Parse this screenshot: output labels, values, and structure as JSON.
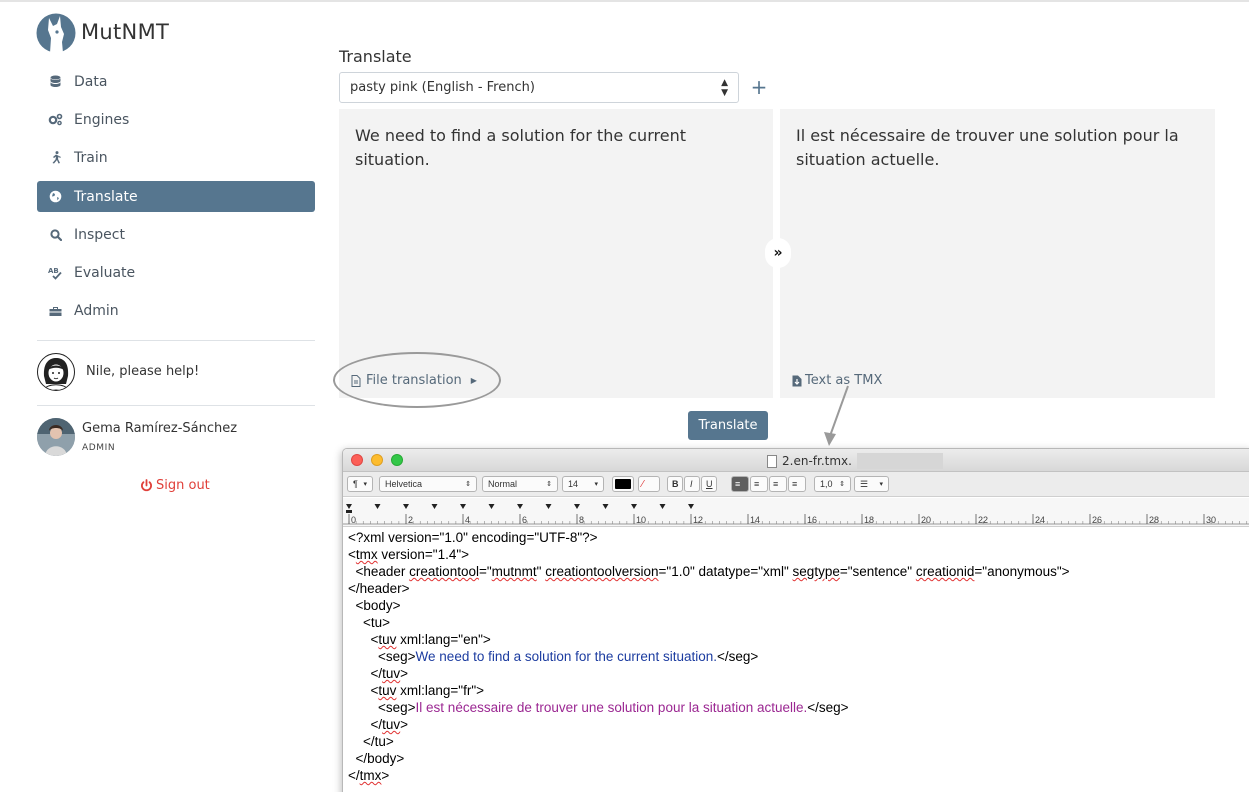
{
  "app": {
    "brand": "MutNMT"
  },
  "sidebar": {
    "items": [
      {
        "label": "Data",
        "icon": "database-icon"
      },
      {
        "label": "Engines",
        "icon": "gears-icon"
      },
      {
        "label": "Train",
        "icon": "running-icon"
      },
      {
        "label": "Translate",
        "icon": "globe-icon",
        "active": true
      },
      {
        "label": "Inspect",
        "icon": "search-icon"
      },
      {
        "label": "Evaluate",
        "icon": "spellcheck-icon"
      },
      {
        "label": "Admin",
        "icon": "toolbox-icon"
      }
    ],
    "help_text": "Nile, please help!",
    "user": {
      "name": "Gema Ramírez-Sánchez",
      "role": "ADMIN"
    },
    "signout_label": "Sign out"
  },
  "colors": {
    "accent": "#56768f",
    "signout": "#e0403a",
    "pane_bg": "#f3f3f3"
  },
  "main": {
    "title": "Translate",
    "engine_select": {
      "value": "pasty pink (English - French)"
    },
    "source_text": "We need to find a solution for the current situation.",
    "target_text": "Il est nécessaire de trouver une solution pour la situation actuelle.",
    "swap_label": "»",
    "file_translation_label": "File translation",
    "tmx_label": "Text as TMX",
    "translate_button": "Translate"
  },
  "overlay_window": {
    "title": "2.en-fr.tmx.",
    "toolbar": {
      "paragraph": "¶",
      "font": "Helvetica",
      "style": "Normal",
      "size": "14",
      "spacing": "1,0"
    },
    "ruler_ticks": [
      "0",
      "2",
      "4",
      "6",
      "8",
      "10",
      "12",
      "14",
      "16",
      "18",
      "20",
      "22",
      "24",
      "26",
      "28",
      "30"
    ],
    "lines": [
      "<?xml version=\"1.0\" encoding=\"UTF-8\"?>",
      "<tmx version=\"1.4\">",
      "  <header creationtool=\"mutnmt\" creationtoolversion=\"1.0\" datatype=\"xml\" segtype=\"sentence\" creationid=\"anonymous\">",
      "</header>",
      "  <body>",
      "    <tu>",
      "      <tuv xml:lang=\"en\">",
      "        <seg>",
      "We need to find a solution for the current situation.",
      "</seg>",
      "      </tuv>",
      "      <tuv xml:lang=\"fr\">",
      "        <seg>",
      "Il est nécessaire de trouver une solution pour la situation actuelle.",
      "</seg>",
      "      </tuv>",
      "    </tu>",
      "  </body>",
      "</tmx>"
    ]
  }
}
